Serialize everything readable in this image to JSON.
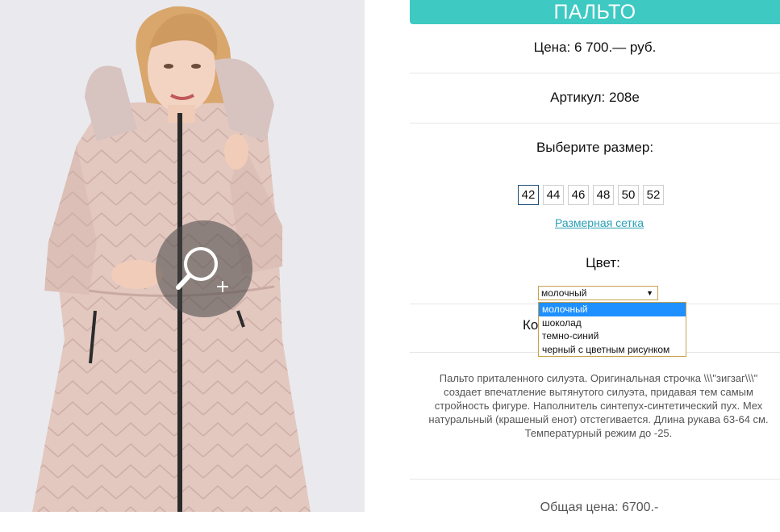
{
  "product": {
    "title": "ПАЛЬТО",
    "price": "Цена: 6 700.— руб.",
    "sku": "Артикул: 208е",
    "size_heading": "Выберите размер:",
    "sizes": [
      "42",
      "44",
      "46",
      "48",
      "50",
      "52"
    ],
    "selected_size": "42",
    "size_chart_link": "Размерная сетка",
    "color_heading": "Цвет:",
    "color_selected": "молочный",
    "color_options": [
      "молочный",
      "шоколад",
      "темно-синий",
      "черный с цветным рисунком"
    ],
    "quantity_partial": "Ко",
    "description": "Пальто приталенного силуэта. Оригинальная строчка \\\\\\\"зигзаг\\\\\\\" создает впечатление вытянутого силуэта, придавая тем самым стройность фигуре. Наполнитель синтепух-синтетический пух. Мех натуральный (крашеный енот) отстегивается. Длина рукава 63-64 см. Температурный режим до -25.",
    "total": "Общая цена: 6700.-"
  },
  "icons": {
    "zoom": "zoom-in-icon",
    "select_arrow": "caret-down-icon"
  },
  "colors": {
    "title_bar": "#3ec9c3",
    "link": "#2a9fb5",
    "selected_option": "#1e90ff",
    "selected_size_border": "#1e4f7a",
    "coat": "#e3c8c0"
  }
}
